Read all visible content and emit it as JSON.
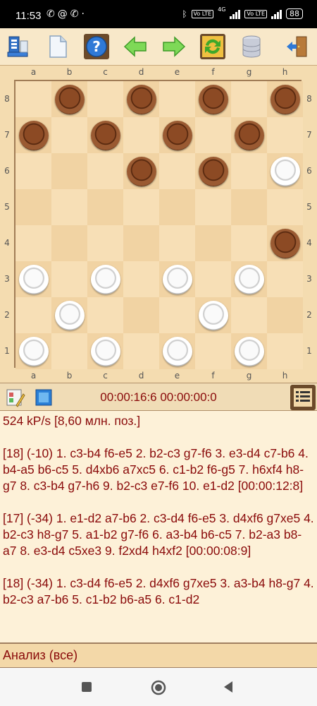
{
  "status": {
    "time": "11:53",
    "left_icons": [
      "phone-icon",
      "at-icon",
      "whatsapp-icon",
      "dot-icon"
    ],
    "right_icons": [
      "bluetooth-icon",
      "volte-icon",
      "signal-icon",
      "volte-icon",
      "signal-icon"
    ],
    "network_4g": "4G",
    "volte_label": "Vo LTE",
    "battery": "88"
  },
  "toolbar": {
    "buttons": [
      "new-game-icon",
      "document-icon",
      "help-icon",
      "undo-arrow-icon",
      "redo-arrow-icon",
      "refresh-icon",
      "database-icon",
      "exit-door-icon"
    ],
    "help_label": "?"
  },
  "board": {
    "files": [
      "a",
      "b",
      "c",
      "d",
      "e",
      "f",
      "g",
      "h"
    ],
    "ranks": [
      "8",
      "7",
      "6",
      "5",
      "4",
      "3",
      "2",
      "1"
    ],
    "colors": {
      "light": "#f7dfb6",
      "dark": "#f1d3a3",
      "black_piece": "#8c4a24",
      "white_piece": "#fafafa"
    },
    "pieces": [
      {
        "sq": "b8",
        "color": "black"
      },
      {
        "sq": "d8",
        "color": "black"
      },
      {
        "sq": "f8",
        "color": "black"
      },
      {
        "sq": "h8",
        "color": "black"
      },
      {
        "sq": "a7",
        "color": "black"
      },
      {
        "sq": "c7",
        "color": "black"
      },
      {
        "sq": "e7",
        "color": "black"
      },
      {
        "sq": "g7",
        "color": "black"
      },
      {
        "sq": "d6",
        "color": "black"
      },
      {
        "sq": "f6",
        "color": "black"
      },
      {
        "sq": "h6",
        "color": "white"
      },
      {
        "sq": "h4",
        "color": "black"
      },
      {
        "sq": "a3",
        "color": "white"
      },
      {
        "sq": "c3",
        "color": "white"
      },
      {
        "sq": "e3",
        "color": "white"
      },
      {
        "sq": "g3",
        "color": "white"
      },
      {
        "sq": "b2",
        "color": "white"
      },
      {
        "sq": "f2",
        "color": "white"
      },
      {
        "sq": "a1",
        "color": "white"
      },
      {
        "sq": "c1",
        "color": "white"
      },
      {
        "sq": "e1",
        "color": "white"
      },
      {
        "sq": "g1",
        "color": "white"
      }
    ]
  },
  "infobar": {
    "timer": "00:00:16:6 00:00:00:0",
    "left_buttons": [
      "board-edit-icon",
      "board-view-icon"
    ],
    "right_button": "moves-list-icon"
  },
  "analysis": {
    "lines": [
      "524 kP/s [8,60 млн. поз.]",
      "[18] (-10)  1. c3-b4 f6-e5 2. b2-c3 g7-f6 3. e3-d4 c7-b6 4. b4-a5 b6-c5 5. d4xb6 a7xc5 6. c1-b2 f6-g5 7. h6xf4 h8-g7 8. c3-b4 g7-h6 9. b2-c3 e7-f6 10. e1-d2  [00:00:12:8]",
      "[17] (-34)  1. e1-d2 a7-b6 2. c3-d4 f6-e5 3. d4xf6 g7xe5 4. b2-c3 h8-g7 5. a1-b2 g7-f6 6. a3-b4 b6-c5 7. b2-a3 b8-a7 8. e3-d4 c5xe3 9. f2xd4 h4xf2  [00:00:08:9]",
      "[18] (-34)  1. c3-d4 f6-e5 2. d4xf6 g7xe5 3. a3-b4 h8-g7 4. b2-c3 a7-b6 5. c1-b2 b6-a5 6. c1-d2"
    ]
  },
  "footer": {
    "label": "Анализ (все)"
  },
  "navbar": {
    "buttons": [
      "recents-square-icon",
      "home-circle-icon",
      "back-triangle-icon"
    ]
  }
}
